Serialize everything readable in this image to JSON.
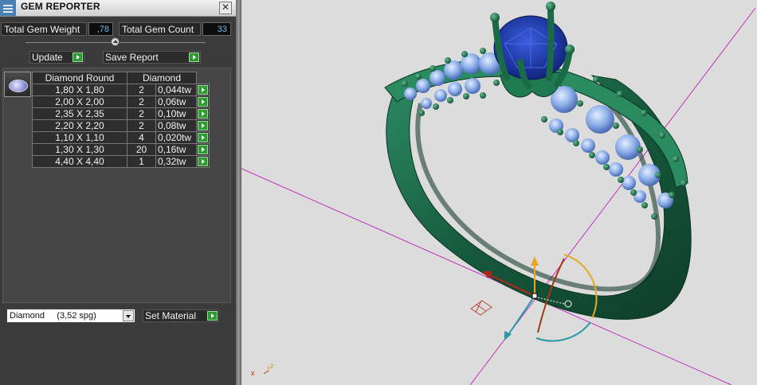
{
  "panel": {
    "title": "GEM REPORTER",
    "close_label": "✕",
    "total_weight_label": "Total Gem Weight",
    "total_weight_value": ",78",
    "total_count_label": "Total Gem Count",
    "total_count_value": "33",
    "update_label": "Update",
    "save_report_label": "Save Report",
    "table": {
      "headers": [
        "Diamond Round",
        "Diamond"
      ],
      "rows": [
        {
          "size": "1,80 X 1,80",
          "count": "2",
          "weight": "0,044tw"
        },
        {
          "size": "2,00 X 2,00",
          "count": "2",
          "weight": "0,06tw"
        },
        {
          "size": "2,35 X 2,35",
          "count": "2",
          "weight": "0,10tw"
        },
        {
          "size": "2,20 X 2,20",
          "count": "2",
          "weight": "0,08tw"
        },
        {
          "size": "1,10 X 1,10",
          "count": "4",
          "weight": "0,020tw"
        },
        {
          "size": "1,30 X 1,30",
          "count": "20",
          "weight": "0,16tw"
        },
        {
          "size": "4,40 X 4,40",
          "count": "1",
          "weight": "0,32tw"
        }
      ]
    },
    "material_value": "Diamond     (3,52 spg)",
    "set_material_label": "Set Material"
  },
  "viewport": {
    "axis_z_label": "z",
    "axis_x_label": "x"
  },
  "colors": {
    "panel_bg": "#3b3b3b",
    "accent_green": "#2f9a2f",
    "value_blue": "#6fb7e8",
    "ring_green": "#1f6b4a",
    "center_stone": "#1d3aa8",
    "side_stones": "#8fb4ec"
  }
}
